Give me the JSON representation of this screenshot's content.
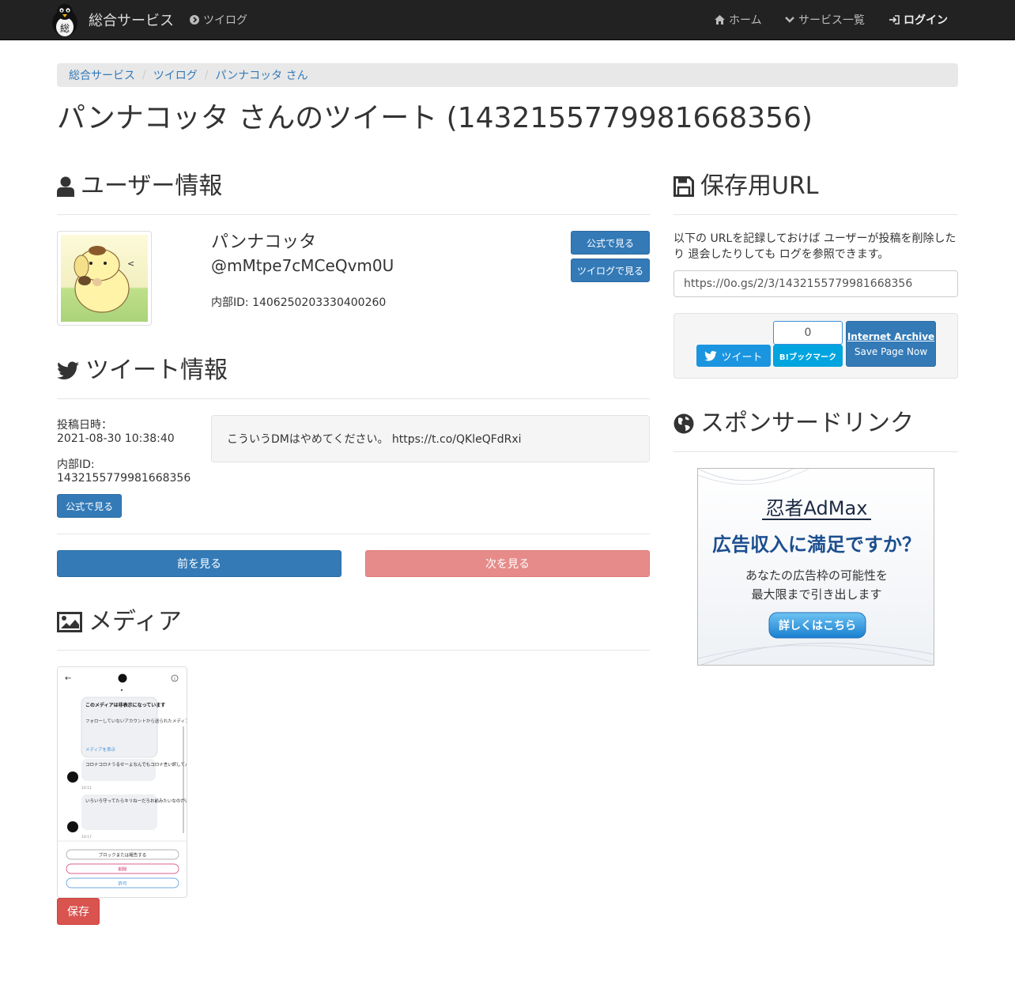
{
  "nav": {
    "brand": "総合サービス",
    "tsuilog": "ツイログ",
    "home": "ホーム",
    "services": "サービス一覧",
    "login": "ログイン"
  },
  "breadcrumb": [
    "総合サービス",
    "ツイログ",
    "パンナコッタ さん"
  ],
  "page_title": "パンナコッタ さんのツイート (1432155779981668356)",
  "user_section": {
    "heading": "ユーザー情報",
    "name": "パンナコッタ",
    "handle": "@mMtpe7cMCeQvm0U",
    "internal_id": "内部ID: 1406250203330400260",
    "btn_official": "公式で見る",
    "btn_tsuilog": "ツイログで見る"
  },
  "tweet_section": {
    "heading": "ツイート情報",
    "posted_label": "投稿日時：",
    "posted_value": "2021-08-30 10:38:40",
    "id_label": "内部ID:",
    "id_value": "1432155779981668356",
    "btn_official": "公式で見る",
    "text": "こういうDMはやめてください。 https://t.co/QKleQFdRxi"
  },
  "pager": {
    "prev": "前を見る",
    "next": "次を見る"
  },
  "media_section": {
    "heading": "メディア",
    "save_button": "保存",
    "screenshot": {
      "card_title": "このメディアは非表示になっています",
      "card_body": "フォローしていないアカウントから送られたメディアです。",
      "card_link": "メディアを表示",
      "msg1": "コロナコロナうるせーよなんでもコロナ言い訳してんじゃねーよwww",
      "time1": "10:11",
      "msg2": "いろいろ守ってたらキリねーだろお前みたいなのがいるからせっかくのイベント楽しかったのに萎えんだよ",
      "time2": "10:17",
      "btn_block": "ブロックまたは報告する",
      "btn_delete": "削除",
      "btn_allow": "許可"
    }
  },
  "save_section": {
    "heading": "保存用URL",
    "description": "以下の URLを記録しておけば ユーザーが投稿を削除したり 退会したりしても ログを参照できます。",
    "url": "https://0o.gs/2/3/1432155779981668356",
    "tweet_btn": "ツイート",
    "bookmark_count": "0",
    "bookmark_btn": "B!ブックマーク",
    "archive_title": "Internet Archive",
    "archive_sub": "Save Page Now"
  },
  "sponsor_section": {
    "heading": "スポンサードリンク",
    "ad": {
      "brand": "忍者AdMax",
      "headline": "広告収入に満足ですか？",
      "line1": "あなたの広告枠の可能性を",
      "line2": "最大限まで引き出します",
      "cta": "詳しくはこちら"
    }
  },
  "colors": {
    "navbar": "#222222",
    "primary": "#337ab7",
    "danger": "#d9534f",
    "danger_light": "#e68b89",
    "twitter": "#1b95e0",
    "hatena": "#00a4de"
  }
}
